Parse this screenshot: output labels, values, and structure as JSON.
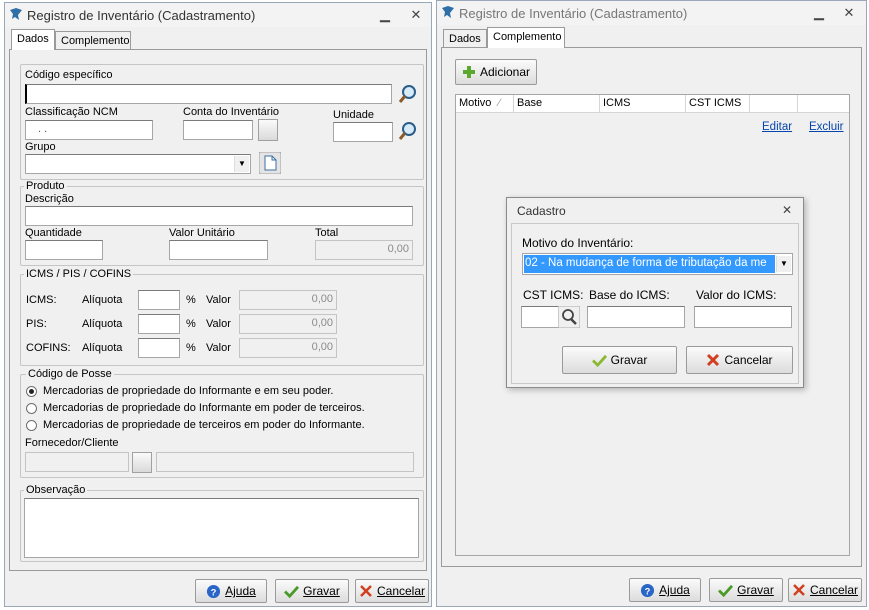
{
  "left": {
    "title": "Registro de Inventário (Cadastramento)",
    "tabs": [
      "Dados",
      "Complemento"
    ],
    "codigo_label": "Código específico",
    "ncm_label": "Classificação NCM",
    "ncm_value": ". .",
    "conta_label": "Conta do Inventário",
    "unidade_label": "Unidade",
    "grupo_label": "Grupo",
    "produto_group": "Produto",
    "descricao_label": "Descrição",
    "quantidade_label": "Quantidade",
    "valor_unit_label": "Valor Unitário",
    "total_label": "Total",
    "total_value": "0,00",
    "tax_group": "ICMS / PIS / COFINS",
    "icms_label": "ICMS:",
    "pis_label": "PIS:",
    "cofins_label": "COFINS:",
    "aliquota_label": "Alíquota",
    "percent": "%",
    "valor_label": "Valor",
    "icms_valor": "0,00",
    "pis_valor": "0,00",
    "cofins_valor": "0,00",
    "posse_group": "Código de Posse",
    "posse_options": [
      "Mercadorias de propriedade do Informante e em seu poder.",
      "Mercadorias de propriedade do Informante em poder de terceiros.",
      "Mercadorias de propriedade de terceiros em poder do Informante."
    ],
    "fornecedor_label": "Fornecedor/Cliente",
    "obs_group": "Observação",
    "ajuda": "Ajuda",
    "gravar": "Gravar",
    "cancelar": "Cancelar"
  },
  "right": {
    "title": "Registro de Inventário (Cadastramento)",
    "tabs": [
      "Dados",
      "Complemento"
    ],
    "adicionar": "Adicionar",
    "columns": [
      "Motivo",
      "Base",
      "ICMS",
      "CST ICMS"
    ],
    "editar": "Editar",
    "excluir": "Excluir",
    "ajuda": "Ajuda",
    "gravar": "Gravar",
    "cancelar": "Cancelar"
  },
  "dialog": {
    "title": "Cadastro",
    "motivo_label": "Motivo do Inventário:",
    "motivo_value": "02 - Na mudança de forma de tributação da me",
    "cst_label": "CST ICMS:",
    "base_label": "Base do ICMS:",
    "valor_label": "Valor do ICMS:",
    "gravar": "Gravar",
    "cancelar": "Cancelar"
  },
  "colors": {
    "selection": "#3399ff",
    "link": "#0645ad",
    "cancel": "#d04020",
    "confirm": "#4a9a2a"
  }
}
